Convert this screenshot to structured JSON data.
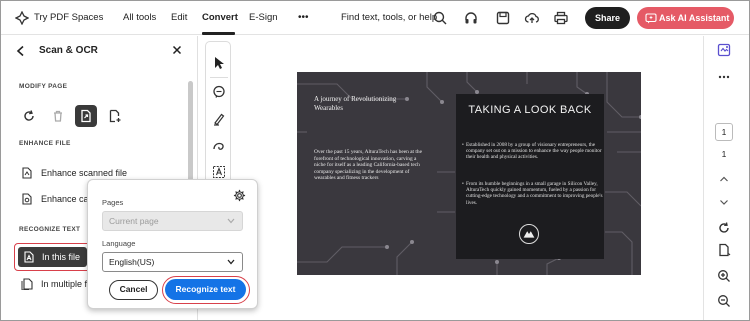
{
  "topbar": {
    "app_name": "Try PDF Spaces",
    "menu": [
      "All tools",
      "Edit",
      "Convert",
      "E-Sign"
    ],
    "more_label": "•••",
    "search_placeholder": "Find text, tools, or help",
    "share_label": "Share",
    "ai_label": "Ask AI Assistant",
    "ai_color": "#e55a66"
  },
  "panel": {
    "title": "Scan & OCR",
    "modify_label": "MODIFY PAGE",
    "enhance_label": "ENHANCE FILE",
    "enhance_items": [
      "Enhance scanned file",
      "Enhance cam"
    ],
    "recognize_label": "RECOGNIZE TEXT",
    "recognize_items": [
      "In this file",
      "In multiple f"
    ]
  },
  "popup": {
    "pages_label": "Pages",
    "pages_value": "Current page",
    "language_label": "Language",
    "language_value": "English(US)",
    "cancel_label": "Cancel",
    "recognize_label": "Recognize text",
    "accent_color": "#1473e6",
    "highlight_color": "#d8404a"
  },
  "document": {
    "left_heading": "A journey of Revolutionizing Wearables",
    "left_body": "Over the past 15 years, AlturaTech has been at the forefront of technological innovation, carving a niche for itself as a leading California-based tech company specializing in the development of wearables and fitness trackers",
    "title": "TAKING A LOOK BACK",
    "bullet1": "Established in 2008 by a group of visionary entrepreneurs, the company set out on a mission to enhance the way people monitor their health and physical activities.",
    "bullet2": "From its humble beginnings in a small garage in Silicon Valley, AlturaTech quickly gained momentum, fueled by a passion for cutting-edge technology and a commitment to improving people's lives."
  },
  "rail": {
    "page_current": "1",
    "page_total": "1"
  }
}
